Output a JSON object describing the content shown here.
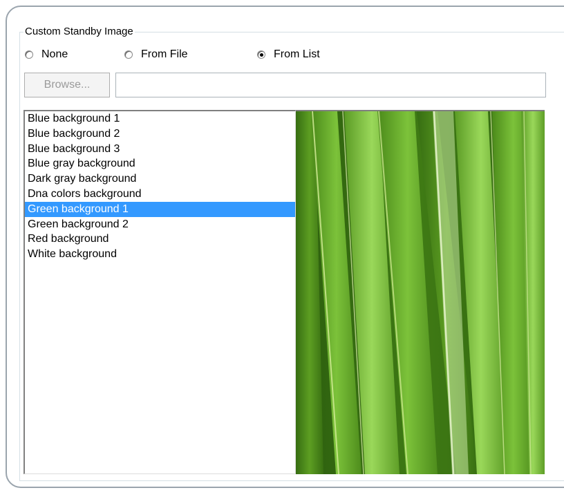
{
  "group": {
    "legend": "Custom Standby Image"
  },
  "source_options": [
    {
      "label": "None",
      "checked": false
    },
    {
      "label": "From File",
      "checked": false
    },
    {
      "label": "From List",
      "checked": true
    }
  ],
  "file": {
    "browse_label": "Browse...",
    "browse_enabled": false,
    "path_value": ""
  },
  "image_list": {
    "items": [
      "Blue background 1",
      "Blue background 2",
      "Blue background 3",
      "Blue gray background",
      "Dark gray background",
      "Dna colors background",
      "Green background 1",
      "Green background 2",
      "Red background",
      "White background"
    ],
    "selected": "Green background 1"
  },
  "colors": {
    "selection": "#3399ff",
    "frame": "#9aa4ad"
  }
}
